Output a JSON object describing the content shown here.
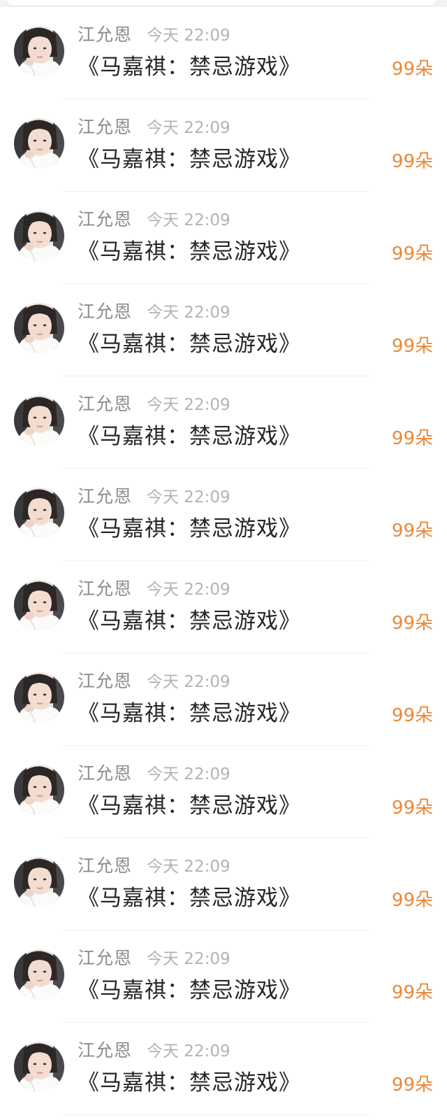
{
  "gift_list": {
    "rows": [
      {
        "name": "江允恩",
        "time": "今天 22:09",
        "message": "《马嘉祺：禁忌游戏》",
        "amount": "99朵"
      },
      {
        "name": "江允恩",
        "time": "今天 22:09",
        "message": "《马嘉祺：禁忌游戏》",
        "amount": "99朵"
      },
      {
        "name": "江允恩",
        "time": "今天 22:09",
        "message": "《马嘉祺：禁忌游戏》",
        "amount": "99朵"
      },
      {
        "name": "江允恩",
        "time": "今天 22:09",
        "message": "《马嘉祺：禁忌游戏》",
        "amount": "99朵"
      },
      {
        "name": "江允恩",
        "time": "今天 22:09",
        "message": "《马嘉祺：禁忌游戏》",
        "amount": "99朵"
      },
      {
        "name": "江允恩",
        "time": "今天 22:09",
        "message": "《马嘉祺：禁忌游戏》",
        "amount": "99朵"
      },
      {
        "name": "江允恩",
        "time": "今天 22:09",
        "message": "《马嘉祺：禁忌游戏》",
        "amount": "99朵"
      },
      {
        "name": "江允恩",
        "time": "今天 22:09",
        "message": "《马嘉祺：禁忌游戏》",
        "amount": "99朵"
      },
      {
        "name": "江允恩",
        "time": "今天 22:09",
        "message": "《马嘉祺：禁忌游戏》",
        "amount": "99朵"
      },
      {
        "name": "江允恩",
        "time": "今天 22:09",
        "message": "《马嘉祺：禁忌游戏》",
        "amount": "99朵"
      },
      {
        "name": "江允恩",
        "time": "今天 22:09",
        "message": "《马嘉祺：禁忌游戏》",
        "amount": "99朵"
      },
      {
        "name": "江允恩",
        "time": "今天 22:09",
        "message": "《马嘉祺：禁忌游戏》",
        "amount": "99朵"
      }
    ]
  },
  "colors": {
    "amount": "#e8893a",
    "name": "#8c8c8c",
    "time": "#b3b3b3",
    "message": "#262626"
  },
  "icons": {
    "avatar": "user-avatar-photo"
  }
}
